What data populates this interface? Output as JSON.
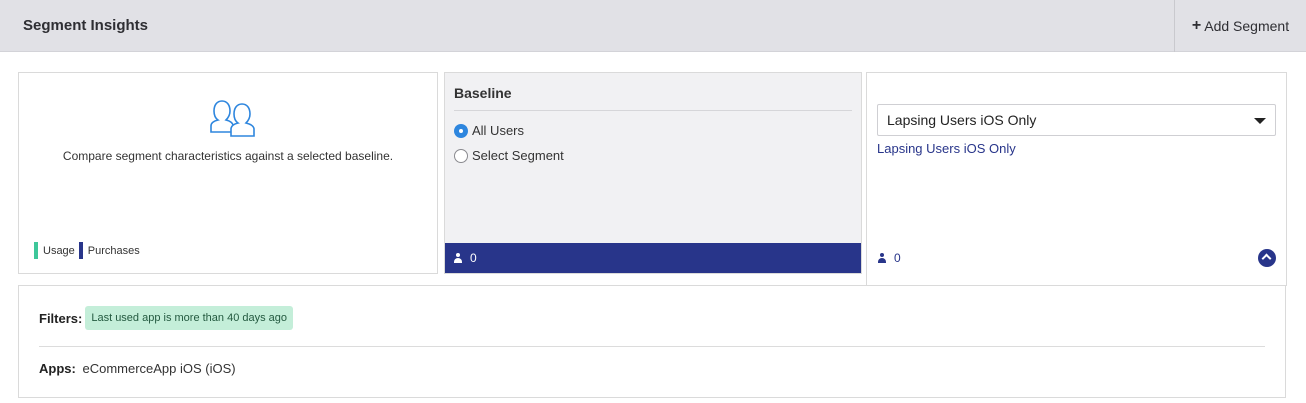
{
  "header": {
    "title": "Segment Insights",
    "add_label": "Add Segment"
  },
  "intro": {
    "description": "Compare segment characteristics against a selected baseline.",
    "legend": [
      {
        "label": "Usage",
        "color": "#3ec79a"
      },
      {
        "label": "Purchases",
        "color": "#28358a"
      }
    ]
  },
  "baseline": {
    "title": "Baseline",
    "options": [
      {
        "label": "All Users",
        "selected": true
      },
      {
        "label": "Select Segment",
        "selected": false
      }
    ],
    "count": "0"
  },
  "segment": {
    "selected": "Lapsing Users iOS Only",
    "link": "Lapsing Users iOS Only",
    "count": "0"
  },
  "details": {
    "filters_label": "Filters:",
    "filter": "Last used app is more than 40 days ago",
    "apps_label": "Apps:",
    "apps_value": "eCommerceApp iOS (iOS)"
  },
  "colors": {
    "header_bg": "#e1e1e6",
    "accent": "#28358a",
    "radio_selected": "#2e86de",
    "filter_badge_bg": "#c4eed9"
  }
}
